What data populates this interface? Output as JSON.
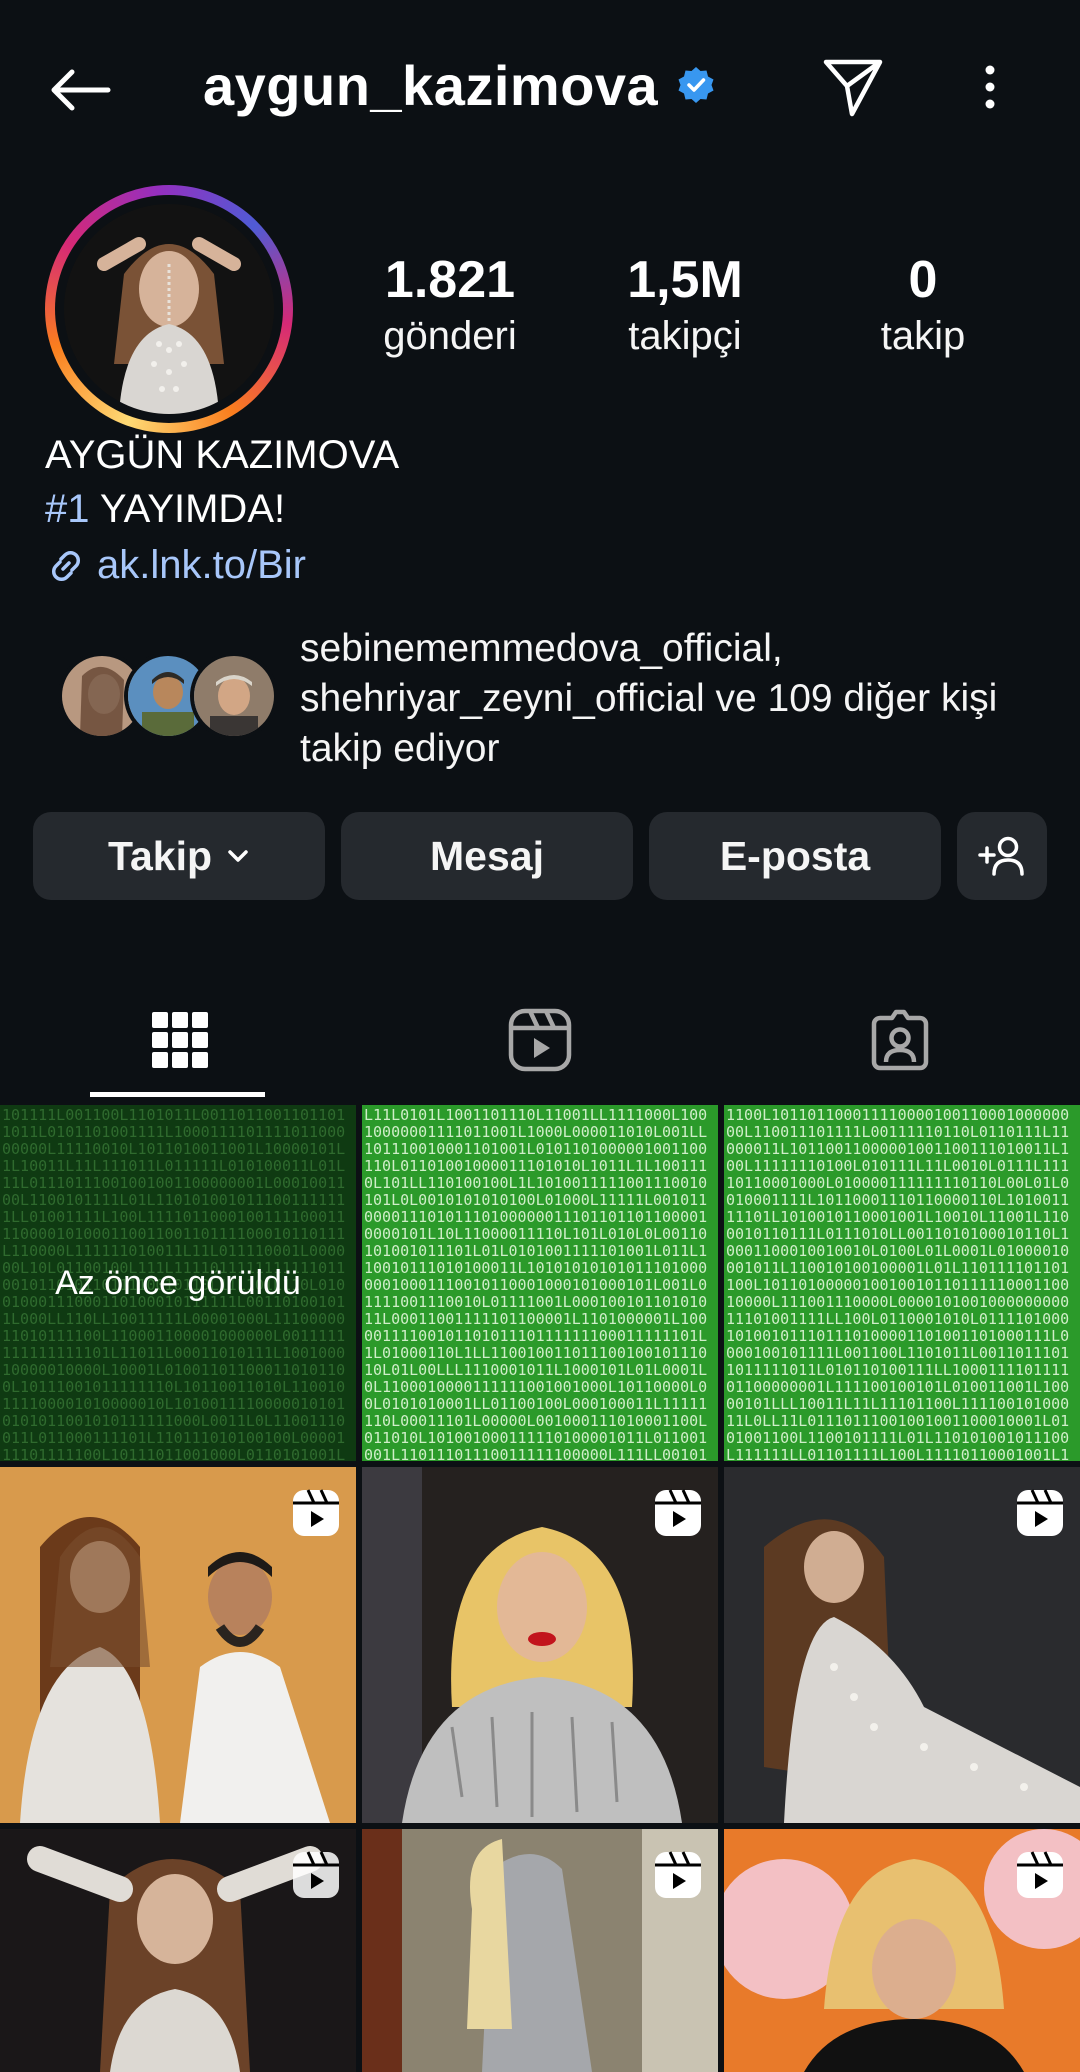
{
  "header": {
    "username": "aygun_kazimova"
  },
  "stats": {
    "posts_count": "1.821",
    "posts_label": "gönderi",
    "followers_count": "1,5M",
    "followers_label": "takipçi",
    "following_count": "0",
    "following_label": "takip"
  },
  "bio": {
    "name": "AYGÜN KAZIMOVA",
    "hashtag": "#1",
    "line_text": " YAYIMDA!",
    "link": "ak.lnk.to/Bir"
  },
  "followed_by": {
    "text": "sebinememmedova_official, shehriyar_zeyni_official ve 109 diğer kişi takip ediyor"
  },
  "actions": {
    "follow_label": "Takip",
    "message_label": "Mesaj",
    "email_label": "E-posta"
  },
  "grid": {
    "seen_label": "Az önce görüldü"
  },
  "colors": {
    "background": "#0c1014",
    "button": "#25292e",
    "link": "#a8c7fa",
    "verified": "#3897f0"
  }
}
